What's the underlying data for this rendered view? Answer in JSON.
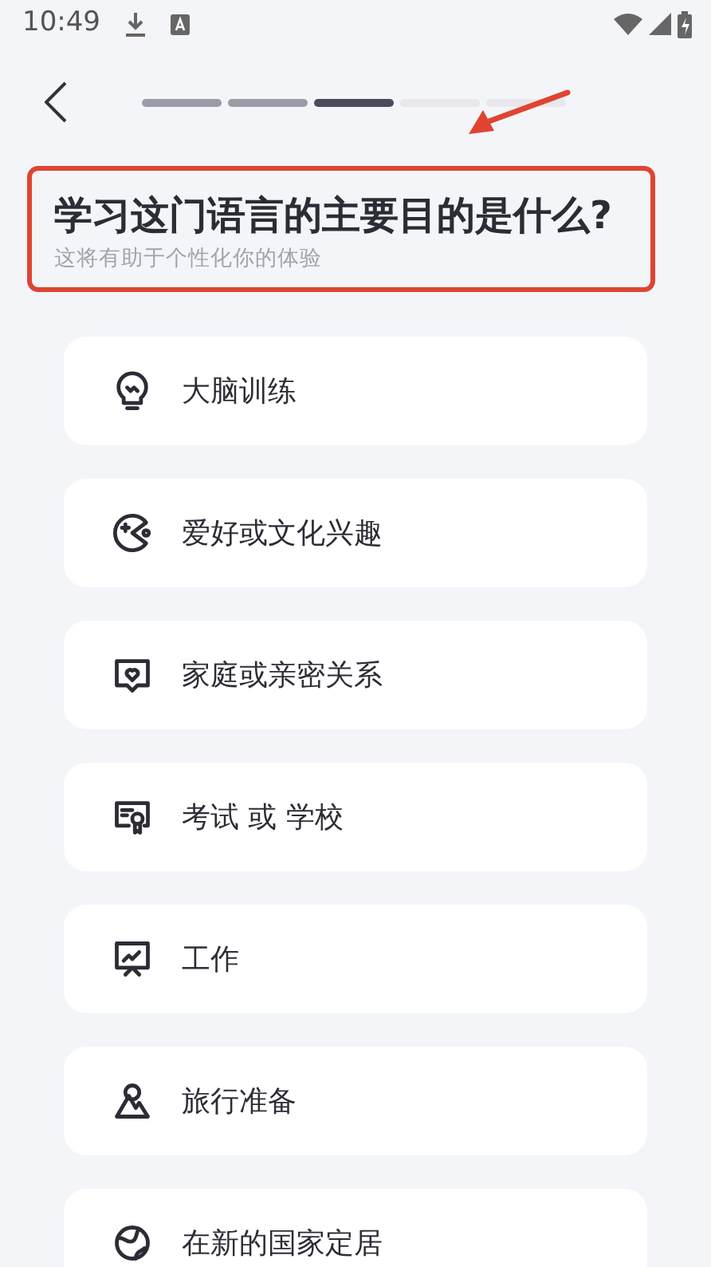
{
  "status_bar": {
    "time": "10:49"
  },
  "progress": [
    {
      "completed": true,
      "selected": false
    },
    {
      "completed": true,
      "selected": false
    },
    {
      "completed": false,
      "selected": true
    },
    {
      "completed": false,
      "selected": false
    },
    {
      "completed": false,
      "selected": false
    }
  ],
  "annotation": {
    "arrow": true,
    "frame": true
  },
  "question": {
    "title": "学习这门语言的主要目的是什么?",
    "subtitle": "这将有助于个性化你的体验"
  },
  "options": [
    {
      "label": "大脑训练"
    },
    {
      "label": "爱好或文化兴趣"
    },
    {
      "label": "家庭或亲密关系"
    },
    {
      "label": "考试 或 学校"
    },
    {
      "label": "工作"
    },
    {
      "label": "旅行准备"
    },
    {
      "label": "在新的国家定居"
    }
  ]
}
